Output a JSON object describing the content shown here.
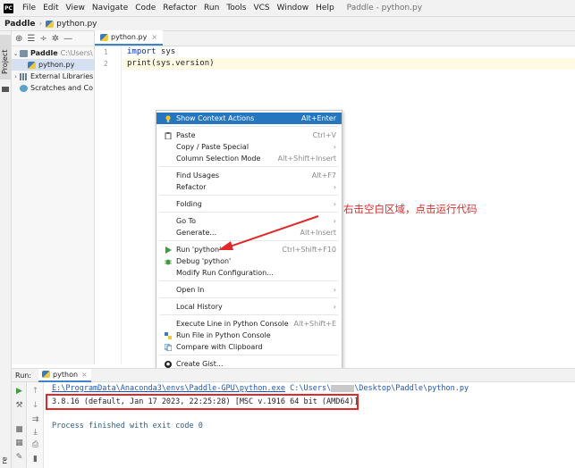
{
  "menubar": {
    "app_icon": "PC",
    "items": [
      "File",
      "Edit",
      "View",
      "Navigate",
      "Code",
      "Refactor",
      "Run",
      "Tools",
      "VCS",
      "Window",
      "Help"
    ],
    "window_title": "Paddle - python.py"
  },
  "breadcrumb": {
    "project": "Paddle",
    "file": "python.py"
  },
  "left_strip": {
    "project_tab": "Project",
    "bottom_tab": "re"
  },
  "project_tree": {
    "root_name": "Paddle",
    "root_path": "C:\\Users\\",
    "file": "python.py",
    "external_libraries": "External Libraries",
    "scratches": "Scratches and Co"
  },
  "editor": {
    "tab_label": "python.py",
    "line_numbers": [
      "1",
      "2"
    ],
    "line1_keyword": "import",
    "line1_rest": " sys",
    "line2": "print(sys.version)"
  },
  "context_menu": {
    "items": [
      {
        "label": "Show Context Actions",
        "shortcut": "Alt+Enter",
        "icon": "lightbulb-icon"
      },
      {
        "label": "Paste",
        "shortcut": "Ctrl+V",
        "icon": "clipboard-icon"
      },
      {
        "label": "Copy / Paste Special",
        "submenu": "›"
      },
      {
        "label": "Column Selection Mode",
        "shortcut": "Alt+Shift+Insert"
      },
      {
        "label": "Find Usages",
        "shortcut": "Alt+F7"
      },
      {
        "label": "Refactor",
        "submenu": "›"
      },
      {
        "label": "Folding",
        "submenu": "›"
      },
      {
        "label": "Go To",
        "submenu": "›"
      },
      {
        "label": "Generate...",
        "shortcut": "Alt+Insert"
      },
      {
        "label": "Run 'python'",
        "shortcut": "Ctrl+Shift+F10",
        "icon": "run-icon"
      },
      {
        "label": "Debug 'python'",
        "icon": "debug-icon"
      },
      {
        "label": "Modify Run Configuration..."
      },
      {
        "label": "Open In",
        "submenu": "›"
      },
      {
        "label": "Local History",
        "submenu": "›"
      },
      {
        "label": "Execute Line in Python Console",
        "shortcut": "Alt+Shift+E"
      },
      {
        "label": "Run File in Python Console",
        "icon": "python-console-icon"
      },
      {
        "label": "Compare with Clipboard",
        "icon": "compare-icon"
      },
      {
        "label": "Create Gist...",
        "icon": "github-icon"
      }
    ]
  },
  "annotation": {
    "text": "右击空白区域，点击运行代码",
    "color": "#e02a2a"
  },
  "run_panel": {
    "title": "Run:",
    "tab_label": "python",
    "command_path": "E:\\ProgramData\\Anaconda3\\envs\\Paddle-GPU\\python.exe",
    "command_user_prefix": "C:\\Users\\",
    "command_suffix": "\\Desktop\\Paddle\\python.py",
    "version_output": "3.8.16 (default, Jan 17 2023, 22:25:28) [MSC v.1916 64 bit (AMD64)]",
    "exit_message": "Process finished with exit code 0"
  },
  "colors": {
    "accent": "#2675bf",
    "annotation_red": "#e02a2a",
    "keyword": "#0033b3",
    "link": "#2158b7"
  }
}
